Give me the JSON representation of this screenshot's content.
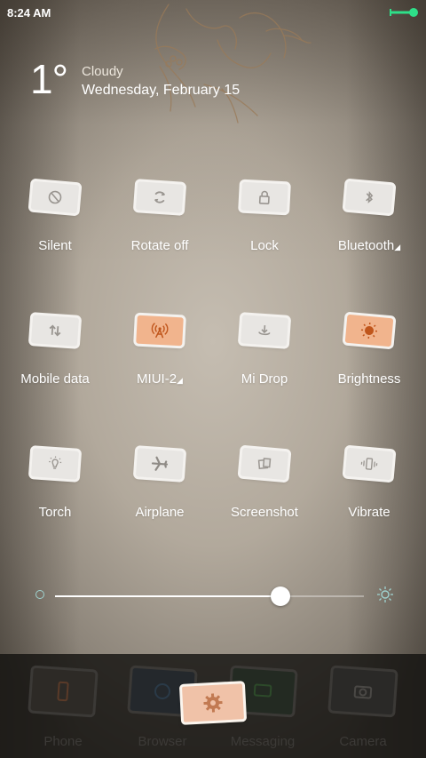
{
  "status_bar": {
    "time": "8:24 AM"
  },
  "weather": {
    "temperature": "1°",
    "condition": "Cloudy",
    "date": "Wednesday, February 15"
  },
  "toggles": [
    {
      "label": "Silent",
      "icon": "silent-icon",
      "active": false,
      "has_menu": false
    },
    {
      "label": "Rotate off",
      "icon": "rotate-icon",
      "active": false,
      "has_menu": false
    },
    {
      "label": "Lock",
      "icon": "lock-icon",
      "active": false,
      "has_menu": false
    },
    {
      "label": "Bluetooth",
      "icon": "bluetooth-icon",
      "active": false,
      "has_menu": true
    },
    {
      "label": "Mobile data",
      "icon": "mobile-data-icon",
      "active": false,
      "has_menu": false
    },
    {
      "label": "MIUI-2",
      "icon": "wifi-icon",
      "active": true,
      "has_menu": true
    },
    {
      "label": "Mi Drop",
      "icon": "mi-drop-icon",
      "active": false,
      "has_menu": false
    },
    {
      "label": "Brightness",
      "icon": "brightness-icon",
      "active": true,
      "has_menu": false
    },
    {
      "label": "Torch",
      "icon": "torch-icon",
      "active": false,
      "has_menu": false
    },
    {
      "label": "Airplane",
      "icon": "airplane-icon",
      "active": false,
      "has_menu": false
    },
    {
      "label": "Screenshot",
      "icon": "screenshot-icon",
      "active": false,
      "has_menu": false
    },
    {
      "label": "Vibrate",
      "icon": "vibrate-icon",
      "active": false,
      "has_menu": false
    }
  ],
  "brightness_slider": {
    "level": 0.73
  },
  "dock": {
    "items": [
      {
        "label": "Phone",
        "icon": "phone-icon"
      },
      {
        "label": "Browser",
        "icon": "browser-icon"
      },
      {
        "label": "Messaging",
        "icon": "messaging-icon"
      },
      {
        "label": "Camera",
        "icon": "camera-icon"
      }
    ],
    "settings_icon": "settings-gear-icon"
  },
  "colors": {
    "active_toggle": "#f1b48d",
    "toggle_icon": "#9a9691",
    "active_icon": "#c0561c",
    "battery": "#2ee089"
  }
}
